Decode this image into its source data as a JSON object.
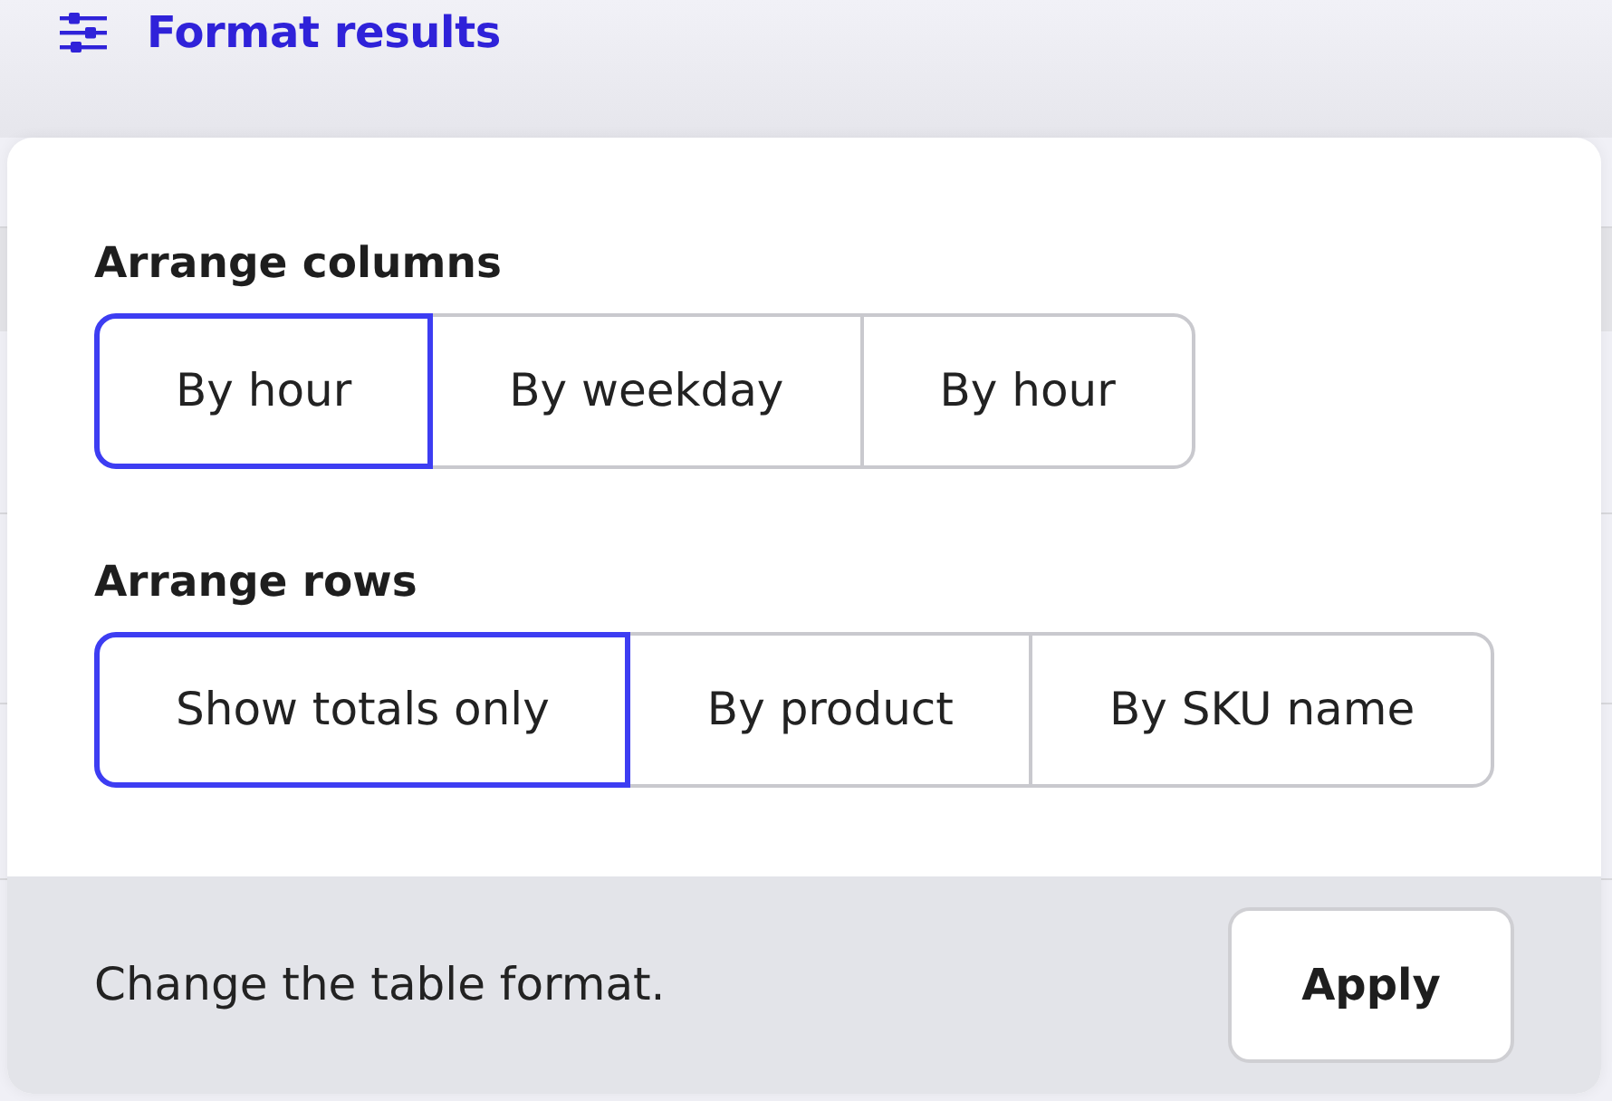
{
  "header": {
    "title": "Format results"
  },
  "popover": {
    "sections": [
      {
        "heading": "Arrange columns",
        "options": [
          {
            "label": "By hour",
            "selected": true
          },
          {
            "label": "By weekday",
            "selected": false
          },
          {
            "label": "By hour",
            "selected": false
          }
        ]
      },
      {
        "heading": "Arrange rows",
        "options": [
          {
            "label": "Show totals only",
            "selected": true
          },
          {
            "label": "By product",
            "selected": false
          },
          {
            "label": "By SKU name",
            "selected": false
          }
        ]
      }
    ],
    "footer": {
      "text": "Change the table format.",
      "button": "Apply"
    }
  }
}
